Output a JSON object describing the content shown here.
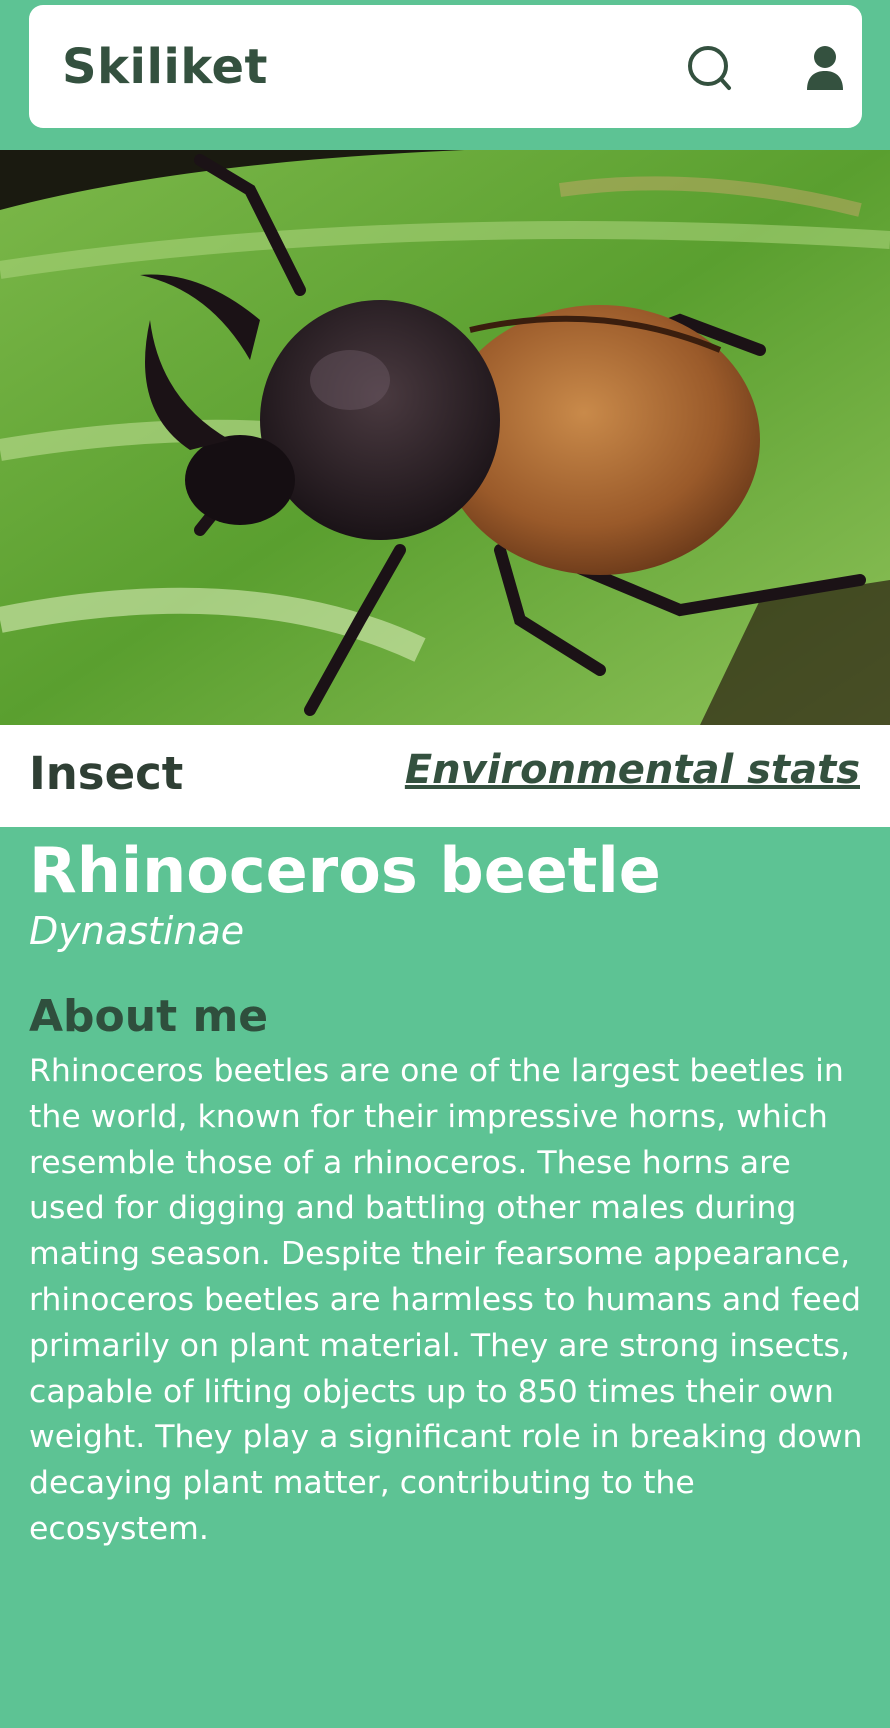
{
  "header": {
    "app_title": "Skiliket",
    "search_icon": "search-icon",
    "profile_icon": "user-icon"
  },
  "hero": {
    "image": "rhinoceros-beetle-on-leaf-photo"
  },
  "tags": {
    "category": "Insect",
    "environment_link": "Environmental stats"
  },
  "species": {
    "common_name": "Rhinoceros beetle",
    "scientific_name": "Dynastinae"
  },
  "about": {
    "heading": "About me",
    "text": "Rhinoceros beetles are one of the largest beetles in the world, known for their impressive horns, which resemble those of a rhinoceros. These horns are used for digging and battling other males during mating season. Despite their fearsome appearance, rhinoceros beetles are harmless to humans and feed primarily on plant material. They are strong insects, capable of lifting objects up to 850 times their own weight. They play a significant role in breaking down decaying plant matter, contributing to the ecosystem."
  },
  "colors": {
    "background": "#5dc394",
    "header_card": "#ffffff",
    "title_text": "#34513f",
    "body_text": "#ffffff"
  }
}
